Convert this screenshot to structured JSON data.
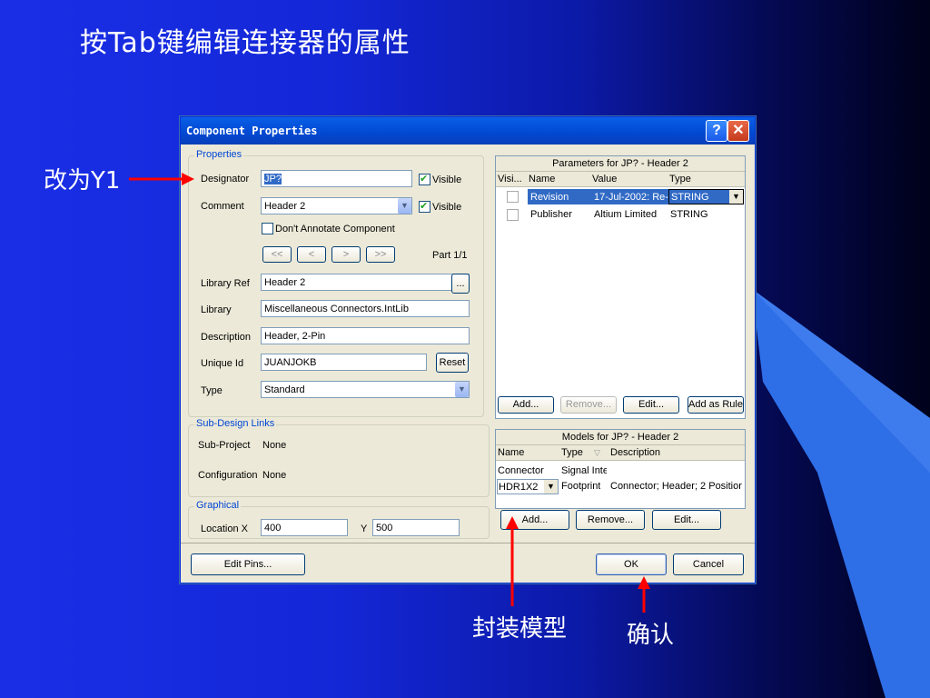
{
  "slide": {
    "title": "按Tab键编辑连接器的属性",
    "annotations": {
      "change_to": "改为Y1",
      "footprint_model": "封装模型",
      "confirm": "确认"
    }
  },
  "dialog": {
    "title": "Component Properties",
    "properties": {
      "group_label": "Properties",
      "designator_label": "Designator",
      "designator_value": "JP?",
      "visible_label": "Visible",
      "comment_label": "Comment",
      "comment_value": "Header 2",
      "comment_visible_label": "Visible",
      "dont_annotate_label": "Don't Annotate Component",
      "nav": [
        "<<",
        "<",
        ">",
        ">>"
      ],
      "part": "Part 1/1",
      "library_ref_label": "Library Ref",
      "library_ref_value": "Header 2",
      "browse": "...",
      "library_label": "Library",
      "library_value": "Miscellaneous Connectors.IntLib",
      "description_label": "Description",
      "description_value": "Header, 2-Pin",
      "unique_id_label": "Unique Id",
      "unique_id_value": "JUANJOKB",
      "reset": "Reset",
      "type_label": "Type",
      "type_value": "Standard"
    },
    "subdesign": {
      "group_label": "Sub-Design Links",
      "subproject_label": "Sub-Project",
      "subproject_value": "None",
      "configuration_label": "Configuration",
      "configuration_value": "None"
    },
    "graphical": {
      "group_label": "Graphical",
      "location_label": "Location X",
      "x_value": "400",
      "y_label": "Y",
      "y_value": "500"
    },
    "parameters": {
      "title": "Parameters for JP? - Header 2",
      "columns": [
        "Visi...",
        "Name",
        "Value",
        "Type"
      ],
      "rows": [
        {
          "name": "Revision",
          "value": "17-Jul-2002: Re-",
          "type": "STRING"
        },
        {
          "name": "Publisher",
          "value": "Altium Limited",
          "type": "STRING"
        }
      ],
      "buttons": [
        "Add...",
        "Remove...",
        "Edit...",
        "Add as Rule"
      ]
    },
    "models": {
      "title": "Models for JP? - Header 2",
      "columns": [
        "Name",
        "Type",
        "Description"
      ],
      "rows": [
        {
          "name": "Connector",
          "type": "Signal Inte",
          "description": ""
        },
        {
          "name": "HDR1X2",
          "type": "Footprint",
          "description": "Connector; Header; 2 Positior"
        }
      ],
      "buttons": [
        "Add...",
        "Remove...",
        "Edit..."
      ]
    },
    "footer": {
      "edit_pins": "Edit Pins...",
      "ok": "OK",
      "cancel": "Cancel"
    }
  },
  "colors": {
    "arrow": "#ff0000",
    "accent": "#0046d5",
    "selection": "#316ac5"
  }
}
